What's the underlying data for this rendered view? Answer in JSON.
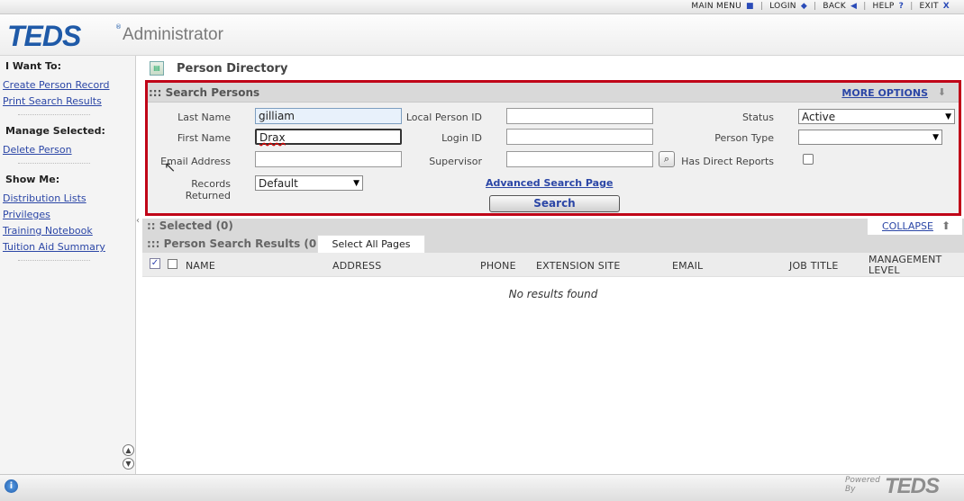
{
  "topnav": {
    "main_menu": "MAIN MENU",
    "login": "LOGIN",
    "back": "BACK",
    "help": "HELP",
    "exit": "EXIT",
    "main_menu_icon": "■",
    "login_icon": "◆",
    "back_icon": "◀",
    "help_icon": "?",
    "exit_icon": "X"
  },
  "header": {
    "logo": "TEDS",
    "logo_reg": "®",
    "app_name": "Administrator"
  },
  "sidebar": {
    "want_heading": "I Want To:",
    "want_links": [
      "Create Person Record",
      "Print Search Results"
    ],
    "manage_heading": "Manage Selected:",
    "manage_links": [
      "Delete Person"
    ],
    "show_heading": "Show Me:",
    "show_links": [
      "Distribution Lists",
      "Privileges",
      "Training Notebook",
      "Tuition Aid Summary"
    ]
  },
  "main": {
    "page_title": "Person Directory",
    "search_panel": {
      "title": "::: Search Persons",
      "more_options": "MORE OPTIONS",
      "last_name_label": "Last Name",
      "last_name_value": "gilliam",
      "first_name_label": "First Name",
      "first_name_value": "Drax",
      "email_label": "Email Address",
      "email_value": "",
      "records_returned_label": "Records Returned",
      "records_returned_value": "Default",
      "local_person_id_label": "Local Person ID",
      "local_person_id_value": "",
      "login_id_label": "Login ID",
      "login_id_value": "",
      "supervisor_label": "Supervisor",
      "supervisor_value": "",
      "status_label": "Status",
      "status_value": "Active",
      "person_type_label": "Person Type",
      "person_type_value": "",
      "direct_reports_label": "Has Direct Reports",
      "advanced_link": "Advanced Search Page",
      "search_button": "Search"
    },
    "selected_title": ":: Selected (0)",
    "collapse": "COLLAPSE",
    "results_title": "::: Person Search Results (0)",
    "select_all_pages": "Select All Pages",
    "columns": {
      "name": "NAME",
      "address": "ADDRESS",
      "phone": "PHONE",
      "extension_site": "EXTENSION SITE",
      "email": "EMAIL",
      "job_title": "JOB TITLE",
      "management_level": "MANAGEMENT LEVEL"
    },
    "no_results": "No results found"
  },
  "footer": {
    "powered_by": "Powered By",
    "powered_logo": "TEDS"
  },
  "colors": {
    "brand_blue": "#1f5aa8",
    "link_blue": "#2b46a6",
    "highlight_red": "#c00418"
  }
}
